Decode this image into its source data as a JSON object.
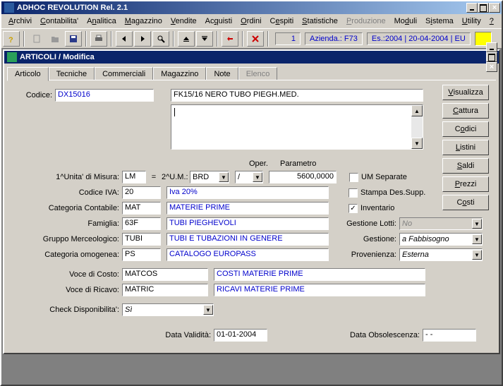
{
  "window": {
    "title": "ADHOC REVOLUTION Rel. 2.1"
  },
  "menu": {
    "archivi": "Archivi",
    "contabilita": "Contabilita'",
    "analitica": "Analitica",
    "magazzino": "Magazzino",
    "vendite": "Vendite",
    "acquisti": "Acquisti",
    "ordini": "Ordini",
    "cespiti": "Cespiti",
    "statistiche": "Statistiche",
    "produzione": "Produzione",
    "moduli": "Moduli",
    "sistema": "Sistema",
    "utility": "Utility",
    "help": "?"
  },
  "status": {
    "num": "1",
    "azienda_label": "Azienda.: F73",
    "es_label": "Es.:2004",
    "data": "20-04-2004",
    "eu": "EU"
  },
  "sub": {
    "title": "ARTICOLI / Modifica"
  },
  "tabs": {
    "articolo": "Articolo",
    "tecniche": "Tecniche",
    "commerciali": "Commerciali",
    "magazzino": "Magazzino",
    "note": "Note",
    "elenco": "Elenco"
  },
  "labels": {
    "codice": "Codice:",
    "um1": "1^Unita' di Misura:",
    "eq": "=",
    "um2": "2^U.M.:",
    "oper": "Oper.",
    "param": "Parametro",
    "codiva": "Codice IVA:",
    "catcont": "Categoria Contabile:",
    "famiglia": "Famiglia:",
    "grpmerc": "Gruppo Merceologico:",
    "catomo": "Categoria omogenea:",
    "vcosto": "Voce di Costo:",
    "vricavo": "Voce di Ricavo:",
    "checkdisp": "Check Disponibilita':",
    "dataval": "Data Validità:",
    "dataobs": "Data Obsolescenza:",
    "umsep": "UM Separate",
    "stampa": "Stampa Des.Supp.",
    "inv": "Inventario",
    "glotti": "Gestione Lotti:",
    "gestione": "Gestione:",
    "prov": "Provenienza:"
  },
  "values": {
    "codice": "DX15016",
    "desc": "FK15/16  NERO   TUBO PIEGH.MED.",
    "um1": "LM",
    "um2": "BRD",
    "oper": "/",
    "param": "5600,0000",
    "iva": "20",
    "iva_desc": "Iva 20%",
    "catcont": "MAT",
    "catcont_desc": "MATERIE PRIME",
    "famiglia": "63F",
    "famiglia_desc": "TUBI PIEGHEVOLI",
    "grpmerc": "TUBI",
    "grpmerc_desc": "TUBI E TUBAZIONI IN GENERE",
    "catomo": "PS",
    "catomo_desc": "CATALOGO EUROPASS",
    "vcosto": "MATCOS",
    "vcosto_desc": "COSTI MATERIE PRIME",
    "vricavo": "MATRIC",
    "vricavo_desc": "RICAVI MATERIE PRIME",
    "checkdisp": "Sì",
    "dataval": "01-01-2004",
    "dataobs": "  -  -",
    "glotti": "No",
    "gestione": "a Fabbisogno",
    "prov": "Esterna",
    "inv_checked": "✓"
  },
  "buttons": {
    "visualizza": "Visualizza",
    "cattura": "Cattura",
    "codici": "Codici",
    "listini": "Listini",
    "saldi": "Saldi",
    "prezzi": "Prezzi",
    "costi": "Costi"
  }
}
